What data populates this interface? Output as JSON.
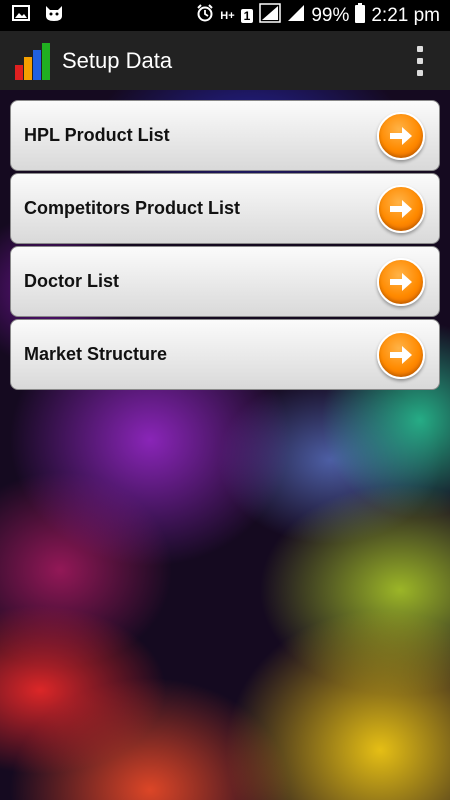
{
  "status_bar": {
    "battery_percent": "99%",
    "time": "2:21 pm",
    "network_type": "H+",
    "sim_slot": "1"
  },
  "action_bar": {
    "title": "Setup Data"
  },
  "menu_items": [
    {
      "label": "HPL Product List"
    },
    {
      "label": "Competitors Product List"
    },
    {
      "label": "Doctor List"
    },
    {
      "label": "Market Structure"
    }
  ],
  "colors": {
    "arrow_accent": "#ff8a00",
    "action_bar": "#222222"
  }
}
